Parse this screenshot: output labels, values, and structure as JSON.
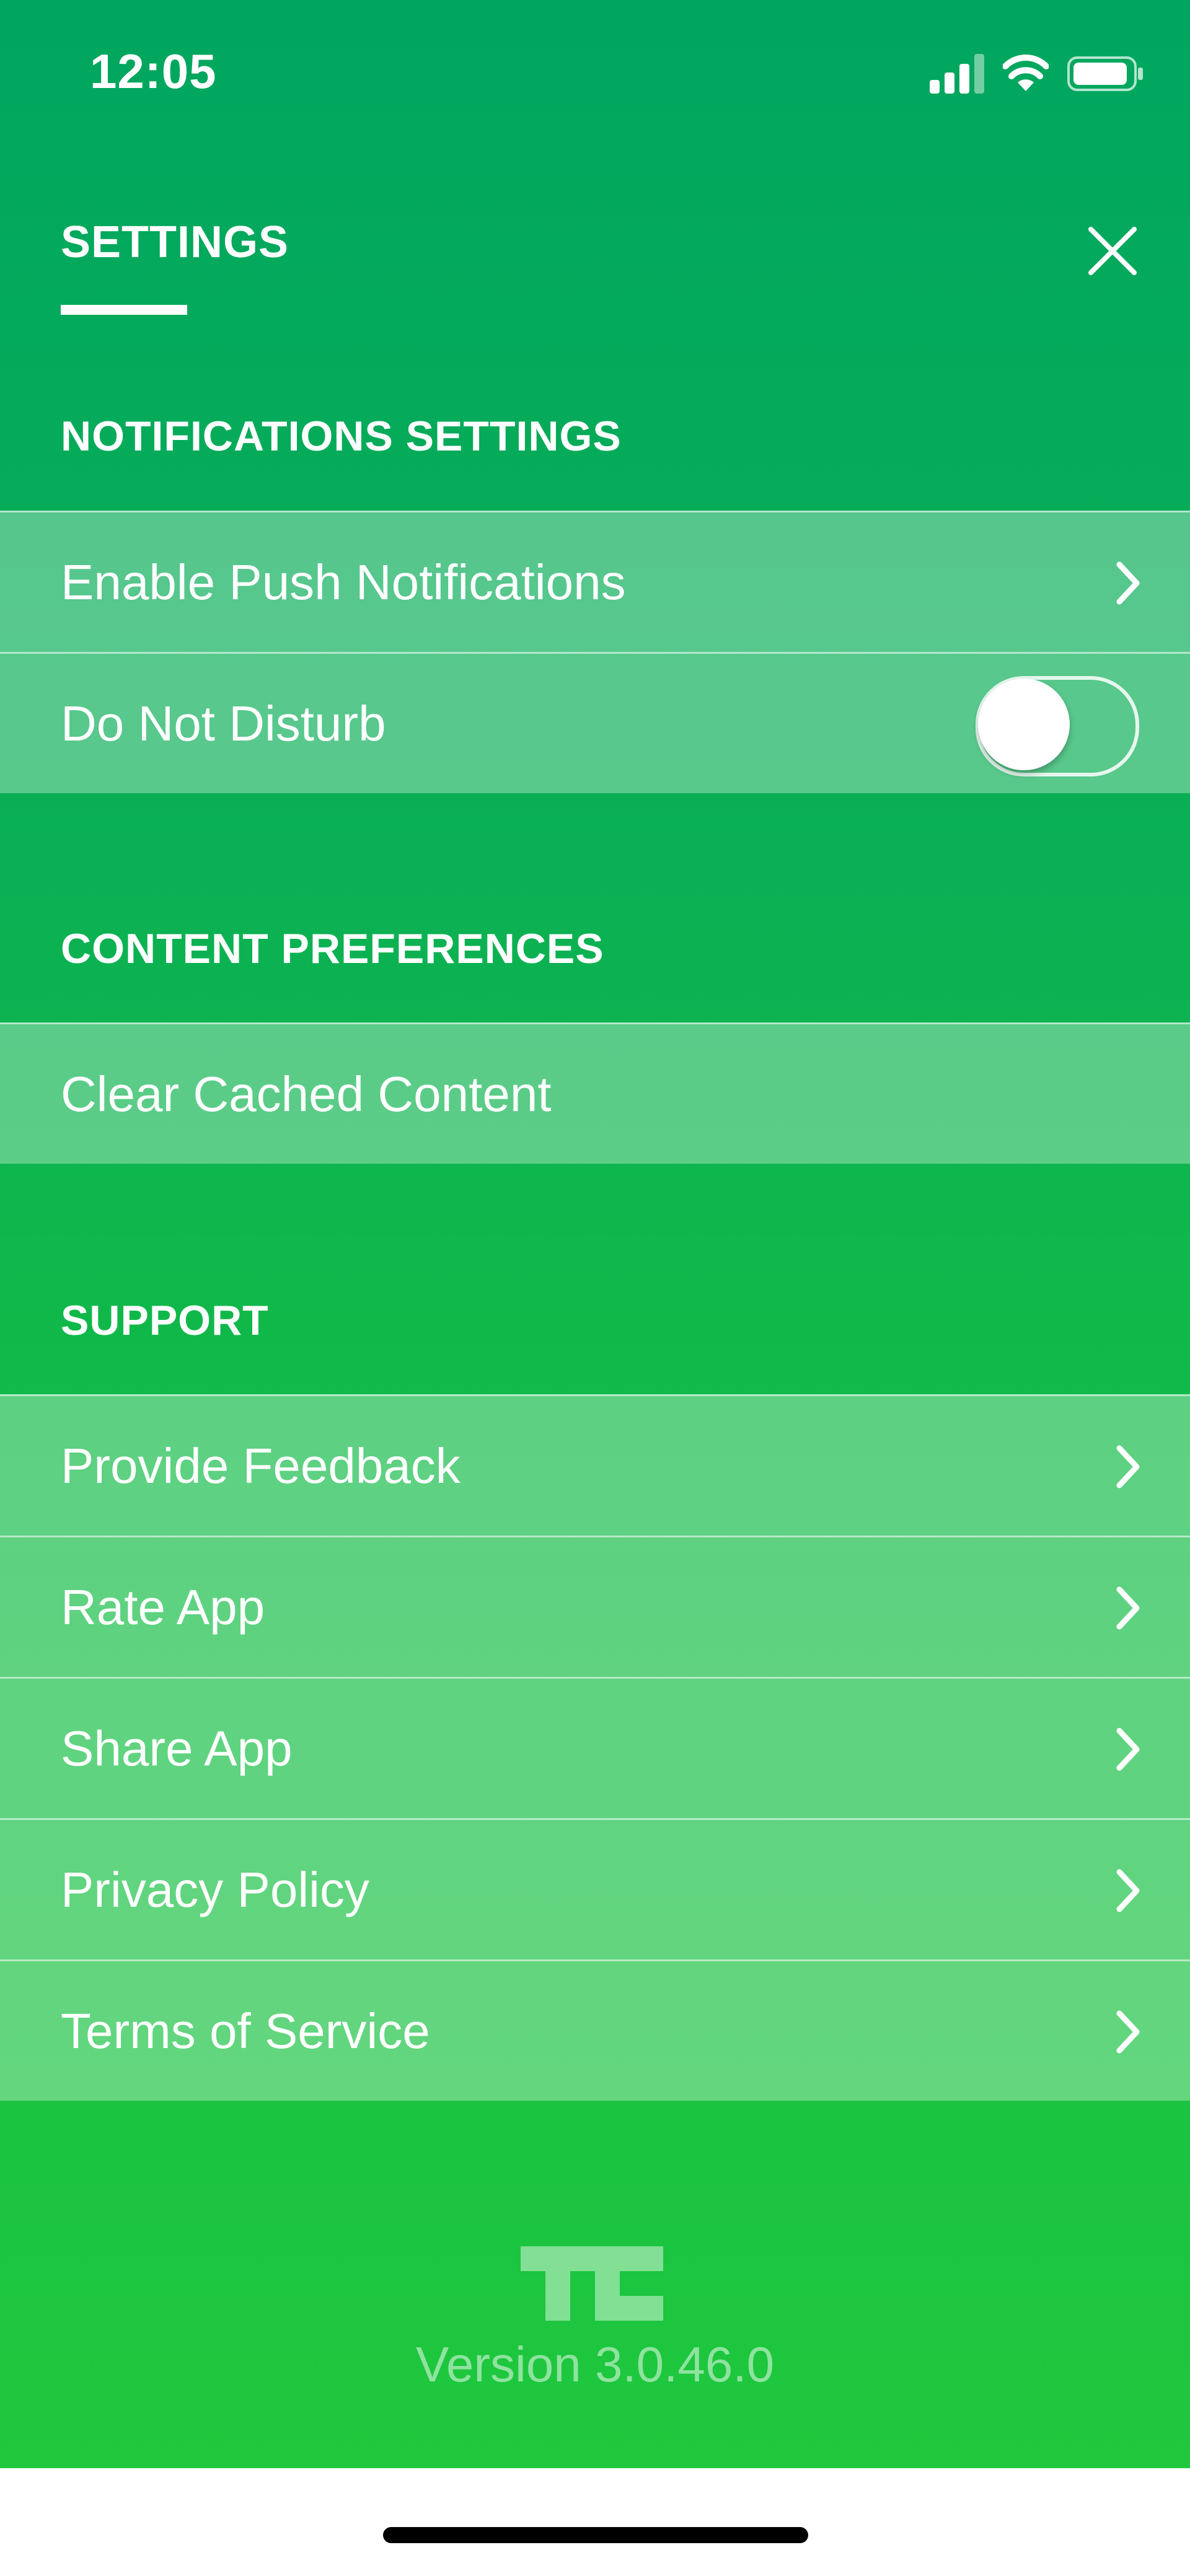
{
  "status_bar": {
    "time": "12:05",
    "icons": [
      "cellular-signal-icon",
      "wifi-icon",
      "battery-icon"
    ]
  },
  "header": {
    "title": "SETTINGS",
    "close_icon": "close-icon"
  },
  "sections": {
    "notifications": {
      "heading": "NOTIFICATIONS SETTINGS",
      "items": [
        {
          "label": "Enable Push Notifications",
          "icon": "chevron-right-icon"
        },
        {
          "label": "Do Not Disturb",
          "toggle_on": false
        }
      ]
    },
    "content": {
      "heading": "CONTENT PREFERENCES",
      "items": [
        {
          "label": "Clear Cached Content"
        }
      ]
    },
    "support": {
      "heading": "SUPPORT",
      "items": [
        {
          "label": "Provide Feedback",
          "icon": "chevron-right-icon"
        },
        {
          "label": "Rate App",
          "icon": "chevron-right-icon"
        },
        {
          "label": "Share App",
          "icon": "chevron-right-icon"
        },
        {
          "label": "Privacy Policy",
          "icon": "chevron-right-icon"
        },
        {
          "label": "Terms of Service",
          "icon": "chevron-right-icon"
        }
      ]
    }
  },
  "footer": {
    "logo": "tc-logo",
    "version": "Version 3.0.46.0"
  },
  "colors": {
    "background_top": "#00a65f",
    "background_bottom": "#1fc83d",
    "text": "#ffffff"
  }
}
